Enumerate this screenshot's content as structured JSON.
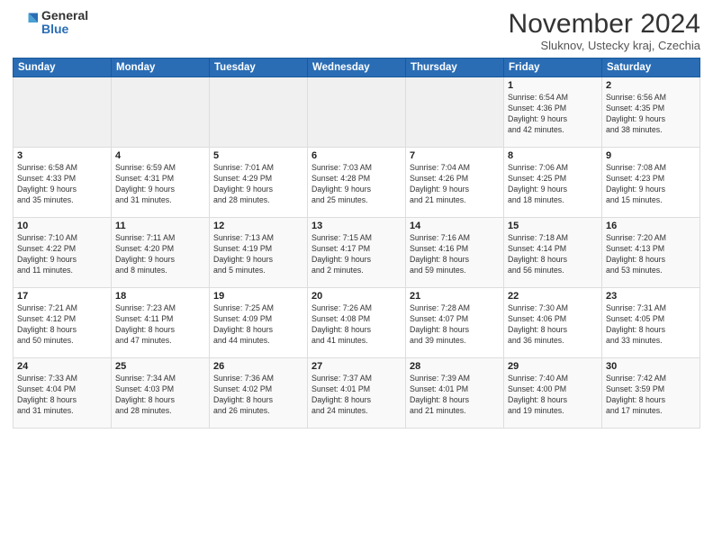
{
  "header": {
    "logo": {
      "general": "General",
      "blue": "Blue"
    },
    "title": "November 2024",
    "location": "Sluknov, Ustecky kraj, Czechia"
  },
  "weekdays": [
    "Sunday",
    "Monday",
    "Tuesday",
    "Wednesday",
    "Thursday",
    "Friday",
    "Saturday"
  ],
  "weeks": [
    [
      {
        "day": "",
        "info": ""
      },
      {
        "day": "",
        "info": ""
      },
      {
        "day": "",
        "info": ""
      },
      {
        "day": "",
        "info": ""
      },
      {
        "day": "",
        "info": ""
      },
      {
        "day": "1",
        "info": "Sunrise: 6:54 AM\nSunset: 4:36 PM\nDaylight: 9 hours\nand 42 minutes."
      },
      {
        "day": "2",
        "info": "Sunrise: 6:56 AM\nSunset: 4:35 PM\nDaylight: 9 hours\nand 38 minutes."
      }
    ],
    [
      {
        "day": "3",
        "info": "Sunrise: 6:58 AM\nSunset: 4:33 PM\nDaylight: 9 hours\nand 35 minutes."
      },
      {
        "day": "4",
        "info": "Sunrise: 6:59 AM\nSunset: 4:31 PM\nDaylight: 9 hours\nand 31 minutes."
      },
      {
        "day": "5",
        "info": "Sunrise: 7:01 AM\nSunset: 4:29 PM\nDaylight: 9 hours\nand 28 minutes."
      },
      {
        "day": "6",
        "info": "Sunrise: 7:03 AM\nSunset: 4:28 PM\nDaylight: 9 hours\nand 25 minutes."
      },
      {
        "day": "7",
        "info": "Sunrise: 7:04 AM\nSunset: 4:26 PM\nDaylight: 9 hours\nand 21 minutes."
      },
      {
        "day": "8",
        "info": "Sunrise: 7:06 AM\nSunset: 4:25 PM\nDaylight: 9 hours\nand 18 minutes."
      },
      {
        "day": "9",
        "info": "Sunrise: 7:08 AM\nSunset: 4:23 PM\nDaylight: 9 hours\nand 15 minutes."
      }
    ],
    [
      {
        "day": "10",
        "info": "Sunrise: 7:10 AM\nSunset: 4:22 PM\nDaylight: 9 hours\nand 11 minutes."
      },
      {
        "day": "11",
        "info": "Sunrise: 7:11 AM\nSunset: 4:20 PM\nDaylight: 9 hours\nand 8 minutes."
      },
      {
        "day": "12",
        "info": "Sunrise: 7:13 AM\nSunset: 4:19 PM\nDaylight: 9 hours\nand 5 minutes."
      },
      {
        "day": "13",
        "info": "Sunrise: 7:15 AM\nSunset: 4:17 PM\nDaylight: 9 hours\nand 2 minutes."
      },
      {
        "day": "14",
        "info": "Sunrise: 7:16 AM\nSunset: 4:16 PM\nDaylight: 8 hours\nand 59 minutes."
      },
      {
        "day": "15",
        "info": "Sunrise: 7:18 AM\nSunset: 4:14 PM\nDaylight: 8 hours\nand 56 minutes."
      },
      {
        "day": "16",
        "info": "Sunrise: 7:20 AM\nSunset: 4:13 PM\nDaylight: 8 hours\nand 53 minutes."
      }
    ],
    [
      {
        "day": "17",
        "info": "Sunrise: 7:21 AM\nSunset: 4:12 PM\nDaylight: 8 hours\nand 50 minutes."
      },
      {
        "day": "18",
        "info": "Sunrise: 7:23 AM\nSunset: 4:11 PM\nDaylight: 8 hours\nand 47 minutes."
      },
      {
        "day": "19",
        "info": "Sunrise: 7:25 AM\nSunset: 4:09 PM\nDaylight: 8 hours\nand 44 minutes."
      },
      {
        "day": "20",
        "info": "Sunrise: 7:26 AM\nSunset: 4:08 PM\nDaylight: 8 hours\nand 41 minutes."
      },
      {
        "day": "21",
        "info": "Sunrise: 7:28 AM\nSunset: 4:07 PM\nDaylight: 8 hours\nand 39 minutes."
      },
      {
        "day": "22",
        "info": "Sunrise: 7:30 AM\nSunset: 4:06 PM\nDaylight: 8 hours\nand 36 minutes."
      },
      {
        "day": "23",
        "info": "Sunrise: 7:31 AM\nSunset: 4:05 PM\nDaylight: 8 hours\nand 33 minutes."
      }
    ],
    [
      {
        "day": "24",
        "info": "Sunrise: 7:33 AM\nSunset: 4:04 PM\nDaylight: 8 hours\nand 31 minutes."
      },
      {
        "day": "25",
        "info": "Sunrise: 7:34 AM\nSunset: 4:03 PM\nDaylight: 8 hours\nand 28 minutes."
      },
      {
        "day": "26",
        "info": "Sunrise: 7:36 AM\nSunset: 4:02 PM\nDaylight: 8 hours\nand 26 minutes."
      },
      {
        "day": "27",
        "info": "Sunrise: 7:37 AM\nSunset: 4:01 PM\nDaylight: 8 hours\nand 24 minutes."
      },
      {
        "day": "28",
        "info": "Sunrise: 7:39 AM\nSunset: 4:01 PM\nDaylight: 8 hours\nand 21 minutes."
      },
      {
        "day": "29",
        "info": "Sunrise: 7:40 AM\nSunset: 4:00 PM\nDaylight: 8 hours\nand 19 minutes."
      },
      {
        "day": "30",
        "info": "Sunrise: 7:42 AM\nSunset: 3:59 PM\nDaylight: 8 hours\nand 17 minutes."
      }
    ]
  ]
}
